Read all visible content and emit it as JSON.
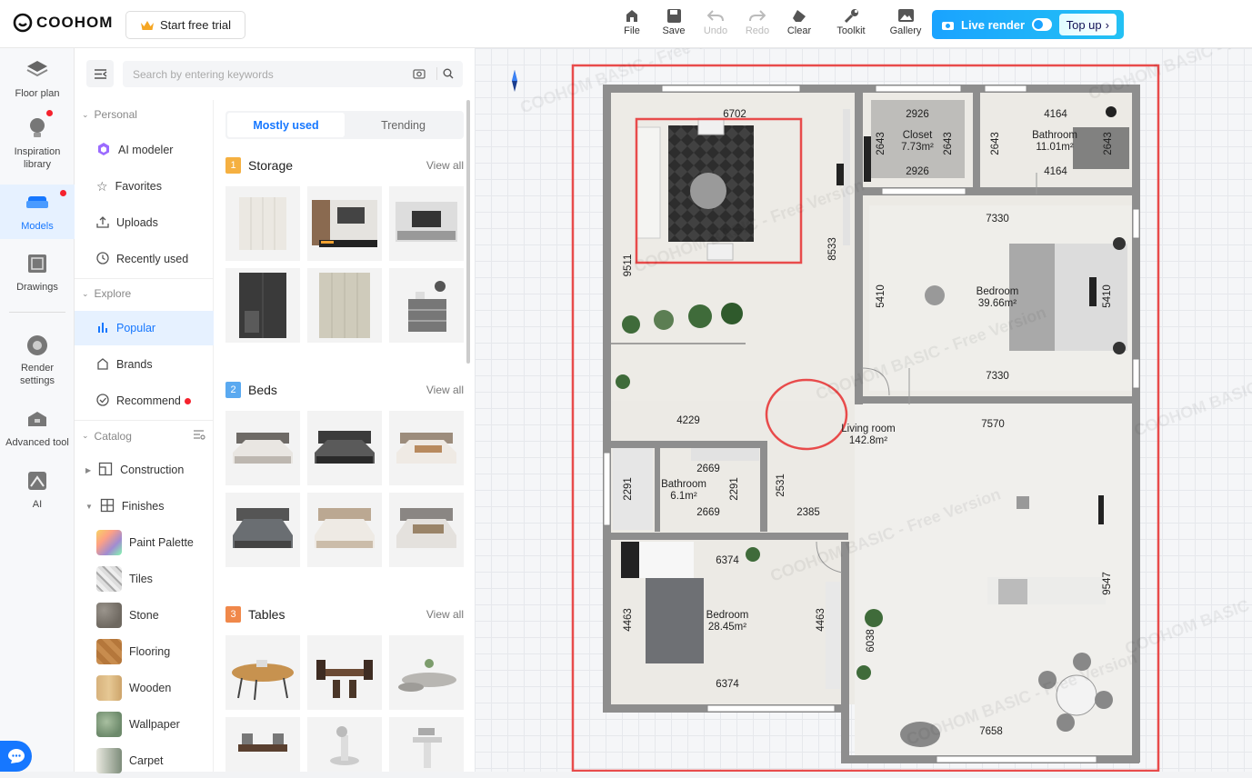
{
  "app": {
    "logo": "COOHOM",
    "trial": "Start free trial"
  },
  "toolbar": {
    "file": "File",
    "save": "Save",
    "undo": "Undo",
    "redo": "Redo",
    "clear": "Clear",
    "toolkit": "Toolkit",
    "gallery": "Gallery",
    "live_render": "Live render",
    "top_up": "Top up"
  },
  "leftnav": [
    {
      "label": "Floor plan",
      "icon": "floor-plan-icon"
    },
    {
      "label": "Inspiration library",
      "icon": "lightbulb-icon"
    },
    {
      "label": "Models",
      "icon": "sofa-icon"
    },
    {
      "label": "Drawings",
      "icon": "drawing-icon"
    },
    {
      "label": "Render settings",
      "icon": "camera-icon"
    },
    {
      "label": "Advanced tool",
      "icon": "toolbox-icon"
    },
    {
      "label": "AI",
      "icon": "ai-icon"
    }
  ],
  "search": {
    "placeholder": "Search by entering keywords"
  },
  "sections": {
    "personal": "Personal",
    "explore": "Explore",
    "catalog": "Catalog"
  },
  "personal_items": [
    "AI modeler",
    "Favorites",
    "Uploads",
    "Recently used"
  ],
  "explore_items": [
    "Popular",
    "Brands",
    "Recommend"
  ],
  "catalog_items": [
    "Construction",
    "Finishes",
    "Paint Palette",
    "Tiles",
    "Stone",
    "Flooring",
    "Wooden",
    "Wallpaper",
    "Carpet"
  ],
  "tabs": [
    "Mostly used",
    "Trending"
  ],
  "categories": [
    {
      "num": "1",
      "name": "Storage",
      "view_all": "View all"
    },
    {
      "num": "2",
      "name": "Beds",
      "view_all": "View all"
    },
    {
      "num": "3",
      "name": "Tables",
      "view_all": "View all"
    }
  ],
  "floorplan": {
    "dims": [
      "6702",
      "9511",
      "8533",
      "2926",
      "2643",
      "2643",
      "2926",
      "4164",
      "2643",
      "2643",
      "4164",
      "7330",
      "5410",
      "5410",
      "7330",
      "4229",
      "7570",
      "2669",
      "2291",
      "2291",
      "2669",
      "2531",
      "2385",
      "6374",
      "4463",
      "4463",
      "6038",
      "6374",
      "9547",
      "7658"
    ],
    "rooms": [
      {
        "name": "Closet",
        "area": "7.73m²"
      },
      {
        "name": "Bathroom",
        "area": "11.01m²"
      },
      {
        "name": "Bedroom",
        "area": "39.66m²"
      },
      {
        "name": "Living room",
        "area": "142.8m²"
      },
      {
        "name": "Bathroom",
        "area": "6.1m²"
      },
      {
        "name": "Bedroom",
        "area": "28.45m²"
      }
    ],
    "watermark": "COOHOM BASIC - Free Version"
  },
  "colors": {
    "accent": "#1677ff",
    "highlight": "#e84b4b",
    "wall": "#8c8c8c"
  }
}
